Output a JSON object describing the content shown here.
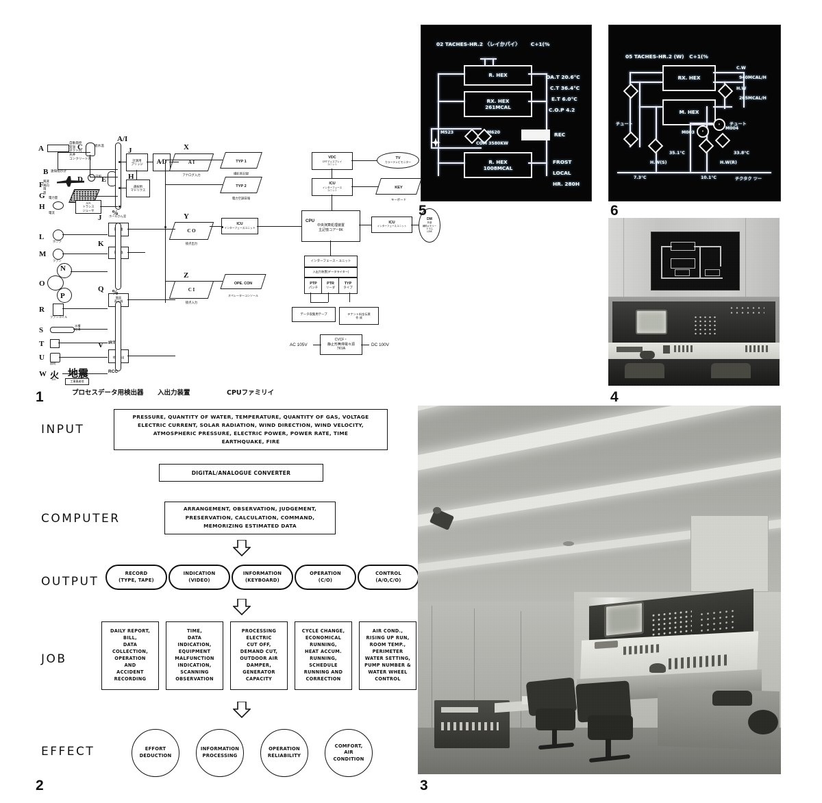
{
  "figures": {
    "fig1": {
      "number": "1",
      "captions": [
        "プロセスデータ用検出器",
        "入出力装置",
        "CPUファミリイ"
      ],
      "column_headers": [
        "A/I",
        "X",
        "Y",
        "Z"
      ],
      "sensor_letters": [
        "A",
        "B",
        "C",
        "D",
        "E",
        "F",
        "G",
        "H",
        "I",
        "J",
        "K",
        "L",
        "M",
        "N",
        "O",
        "P",
        "Q",
        "R",
        "S",
        "T",
        "U",
        "V",
        "W"
      ],
      "sensor_labels": {
        "A": "自動発停",
        "A_sub": "室温 ダクト内 天井 コンクリート内",
        "B": "遠隔指示計",
        "C": "給水温",
        "D": "日照",
        "E": "流量",
        "F": "風速 風向 雨 雪",
        "G": "電力量",
        "H": "電流",
        "I": "A/A トランスジューサ",
        "J": "計測用 ブリッジ",
        "H2": "選択用 マトリクス",
        "J2": "操作盤",
        "K": "操作器",
        "Q": "盤面 表示器",
        "V": "火災 地震検出",
        "W": "火 地震"
      },
      "bus_labels": [
        "%",
        "%",
        "IRT",
        "RCC"
      ],
      "io_units": [
        {
          "code": "A I",
          "jp": "アナログ入力"
        },
        {
          "code": "C O",
          "jp": "接点出力"
        },
        {
          "code": "C I",
          "jp": "接点入力"
        },
        {
          "code": "TYP 1",
          "jp": "細彩率記録"
        },
        {
          "code": "TYP 2",
          "jp": "電力空調日報"
        },
        {
          "code": "OPE. CON",
          "jp": "オペレーターコンソール"
        }
      ],
      "cpu_family": [
        {
          "code": "VDC",
          "jp": "CRTディスプレイユニット"
        },
        {
          "code": "TV",
          "jp": "カラーテレビモニター"
        },
        {
          "code": "ICU",
          "jp": "インターフェースユニット"
        },
        {
          "code": "KEY",
          "jp": "キーボード"
        },
        {
          "code": "ICU",
          "jp": "インターフェースユニット"
        },
        {
          "code": "CPU",
          "jp": "中央演算処理装置 主記憶コアー8K"
        },
        {
          "code": "ICU",
          "jp": "インターフェースユニット"
        },
        {
          "code": "DM",
          "jp": "外部補助メモリー ドラム 128K"
        }
      ],
      "peripherals": {
        "iface": "インターフェース・ユニット",
        "datawriter": "入出力装置(データライター)",
        "cells": [
          [
            "PTP",
            "パンチ"
          ],
          [
            "PTR",
            "リーダ"
          ],
          [
            "TYP",
            "タイプ"
          ]
        ],
        "tape": "データ収集用テープ",
        "bill": "テナント料金伝票 作 成"
      },
      "power": {
        "ac": "AC 105V",
        "dc": "DC 100V",
        "unit": "CVCF・ 静止形無停電々源 7KVA"
      }
    },
    "fig2": {
      "number": "2",
      "stages": [
        "INPUT",
        "COMPUTER",
        "OUTPUT",
        "JOB",
        "EFFECT"
      ],
      "input_text": "PRESSURE, QUANTITY OF WATER, TEMPERATURE, QUANTITY OF GAS, VOLTAGE\nELECTRIC CURRENT, SOLAR RADIATION, WIND DIRECTION, WIND VELOCITY,\nATMOSPHERIC PRESSURE, ELECTRIC POWER, POWER RATE, TIME\nEARTHQUAKE, FIRE",
      "converter_text": "DIGITAL/ANALOGUE CONVERTER",
      "computer_text": "ARRANGEMENT, OBSERVATION, JUDGEMENT,\nPRESERVATION, CALCULATION, COMMAND,\nMEMORIZING ESTIMATED DATA",
      "outputs": [
        "RECORD\n(TYPE, TAPE)",
        "INDICATION\n(VIDEO)",
        "INFORMATION\n(KEYBOARD)",
        "OPERATION\n(C/O)",
        "CONTROL\n(A/O,C/O)"
      ],
      "jobs": [
        "DAILY REPORT,\nBILL,\nDATA\nCOLLECTION,\nOPERATION\nAND\nACCIDENT\nRECORDING",
        "TIME,\nDATA\nINDICATION,\nEQUIPMENT\nMALFUNCTION\nINDICATION,\nSCANNING\nOBSERVATION",
        "PROCESSING\nELECTRIC\nCUT OFF,\nDEMAND CUT,\nOUTDOOR AIR\nDAMPER,\nGENERATOR\nCAPACITY",
        "CYCLE CHANGE,\nECONOMICAL\nRUNNING,\nHEAT ACCUM.\nRUNNING,\nSCHEDULE\nRUNNING AND\nCORRECTION",
        "AIR COND.,\nRISING UP RUN,\nROOM TEMP.,\nPERIMETER\nWATER SETTING,\nPUMP NUMBER &\nWATER WHEEL\nCONTROL"
      ],
      "effects": [
        "EFFORT\nDEDUCTION",
        "INFORMATION\nPROCESSING",
        "OPERATION\nRELIABILITY",
        "COMFORT,\nAIR\nCONDITION"
      ]
    },
    "fig3": {
      "number": "3",
      "subject": "computer control room with console and chairs"
    },
    "fig4": {
      "number": "4",
      "subject": "control console with CRT monitor and wall mimic panel"
    },
    "fig5": {
      "number": "5",
      "header": "02 TACHES-HR.2 〈レイかパイ〉      C+1(%",
      "boxes": [
        {
          "id": "box1",
          "lines": [
            "R. HEX"
          ]
        },
        {
          "id": "box2",
          "lines": [
            "RX. HEX",
            "261MCAL"
          ]
        },
        {
          "id": "box3",
          "lines": [
            "R. HEX",
            "1008MCAL"
          ]
        }
      ],
      "labels": {
        "left_valve": "M523",
        "right_valve": "M620",
        "com": "COM 3580KW",
        "rec": "REC"
      },
      "readings": [
        "OA.T 20.6°C",
        "C.T 36.4°C",
        "E.T 6.0°C",
        "C.O.P 4.2"
      ],
      "status": [
        "FROST",
        "LOCAL",
        "HR. 280H"
      ]
    },
    "fig6": {
      "number": "6",
      "header": "05 TACHES-HR.2 (W)   C+1(%",
      "boxes": [
        {
          "id": "box1",
          "lines": [
            "RX. HEX"
          ]
        },
        {
          "id": "box2",
          "lines": [
            "M. HEX"
          ]
        }
      ],
      "readings": [
        "C.W",
        "940MCAL/H",
        "H.W",
        "265MCAL/H"
      ],
      "point_labels": [
        "M003",
        "M004"
      ],
      "temps": [
        "35.1°C",
        "33.8°C",
        "7.3°C",
        "10.1°C"
      ],
      "line_labels": [
        "H.W(S)",
        "H.W(R)",
        "チュート",
        "チュート",
        "チクタク ツー"
      ]
    }
  }
}
